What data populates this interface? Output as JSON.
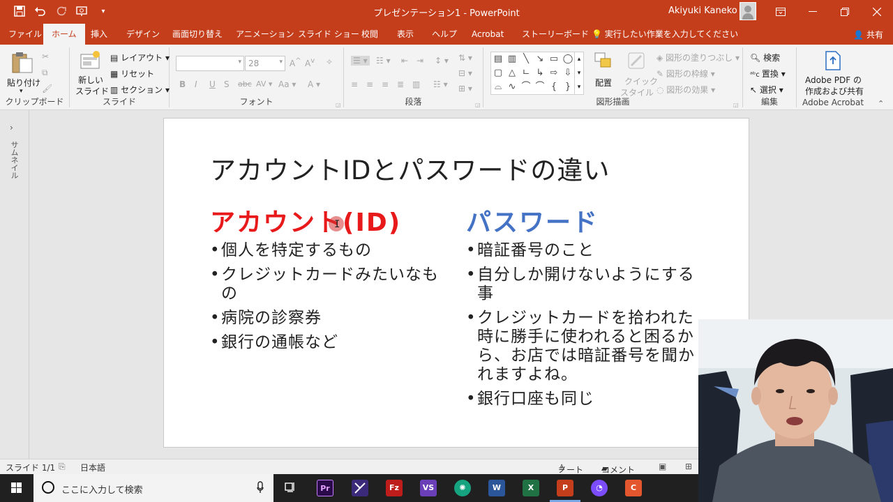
{
  "titlebar": {
    "title": "プレゼンテーション1  -  PowerPoint",
    "user": "Akiyuki Kaneko",
    "accent": "#c43e1c"
  },
  "tabs": [
    "ファイル",
    "ホーム",
    "挿入",
    "デザイン",
    "画面切り替え",
    "アニメーション",
    "スライド ショー",
    "校閲",
    "表示",
    "ヘルプ",
    "Acrobat",
    "ストーリーボード"
  ],
  "tell_me": "実行したい作業を入力してください",
  "share": "共有",
  "ribbon": {
    "clipboard": {
      "paste": "貼り付け",
      "label": "クリップボード"
    },
    "slides": {
      "new_slide_1": "新しい",
      "new_slide_2": "スライド",
      "layout": "レイアウト",
      "reset": "リセット",
      "section": "セクション",
      "label": "スライド"
    },
    "font": {
      "size": "28",
      "label": "フォント"
    },
    "paragraph": {
      "label": "段落"
    },
    "drawing": {
      "arrange": "配置",
      "quick_1": "クイック",
      "quick_2": "スタイル",
      "fill": "図形の塗りつぶし",
      "outline": "図形の枠線",
      "effect": "図形の効果",
      "label": "図形描画"
    },
    "editing": {
      "find": "検索",
      "replace": "置換",
      "select": "選択",
      "label": "編集"
    },
    "acrobat": {
      "line1": "Adobe PDF の",
      "line2": "作成および共有",
      "label": "Adobe Acrobat"
    }
  },
  "side": {
    "label": "サムネイル"
  },
  "slide": {
    "title": "アカウントIDとパスワードの違い",
    "left": {
      "heading": "アカウント(ID)",
      "color": "#e8191a",
      "bullets": [
        "個人を特定するもの",
        "クレジットカードみたいなもの",
        "病院の診察券",
        "銀行の通帳など"
      ]
    },
    "right": {
      "heading": "パスワード",
      "color": "#4472c4",
      "bullets": [
        "暗証番号のこと",
        "自分しか開けないようにする事",
        "クレジットカードを拾われた時に勝手に使われると困るから、お店では暗証番号を聞かれますよね。",
        "銀行口座も同じ"
      ]
    }
  },
  "status": {
    "slide": "スライド 1/1",
    "lang": "日本語",
    "notes": "ノート",
    "comments": "コメント"
  },
  "taskbar": {
    "search_placeholder": "ここに入力して検索"
  }
}
